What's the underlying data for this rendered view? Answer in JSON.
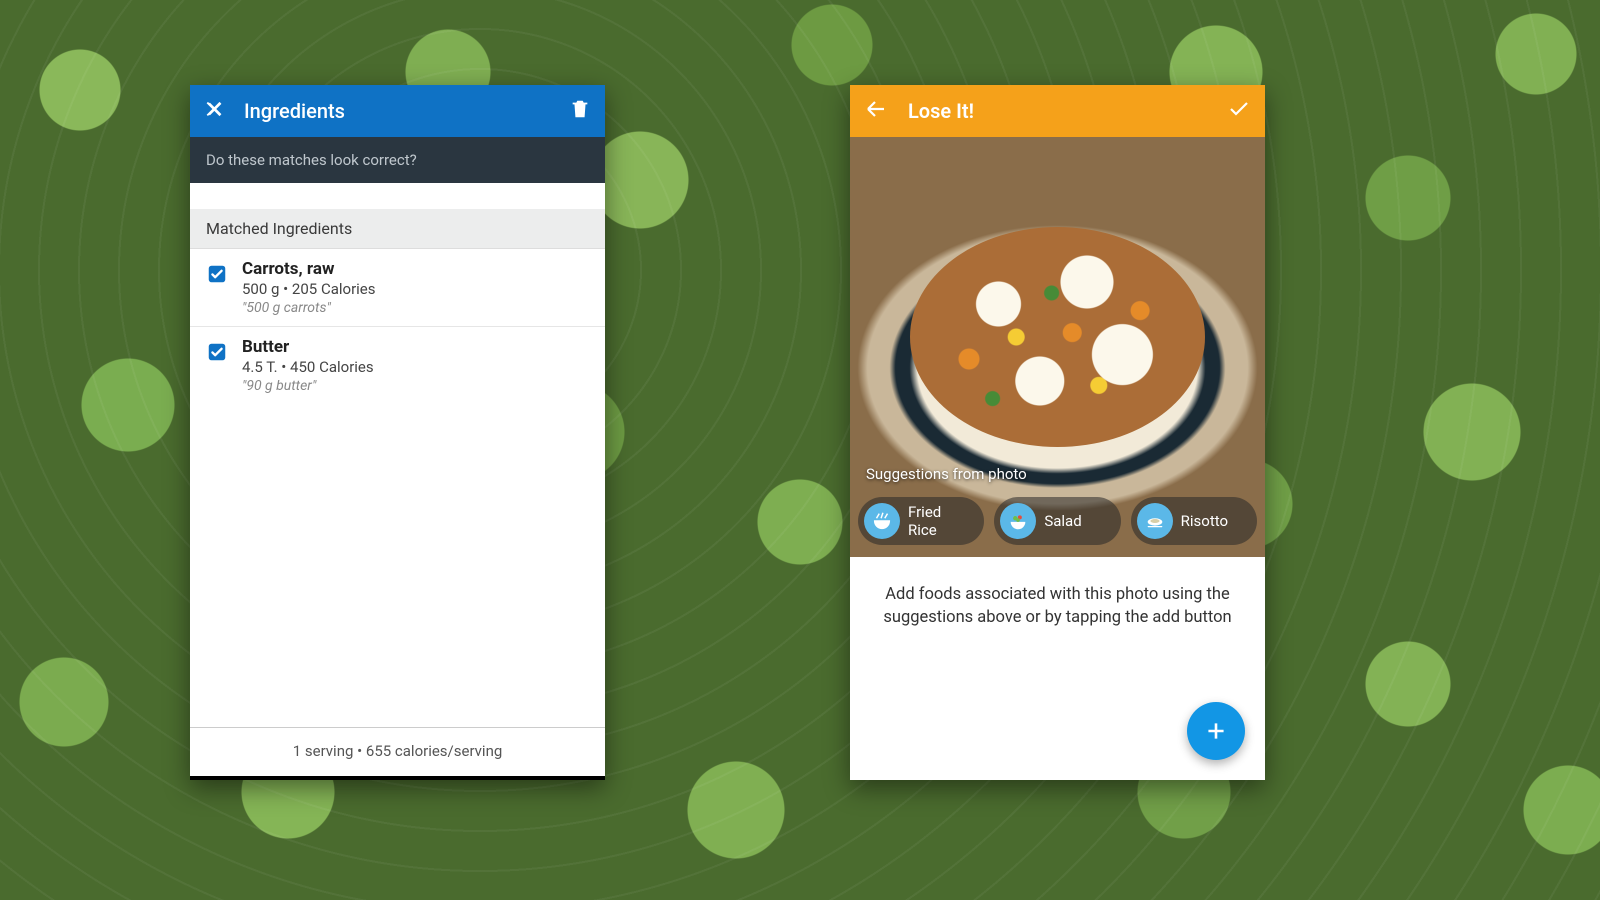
{
  "left": {
    "toolbar_title": "Ingredients",
    "subheader": "Do these matches look correct?",
    "section_label": "Matched Ingredients",
    "items": [
      {
        "name": "Carrots, raw",
        "meta": "500 g • 205 Calories",
        "orig": "\"500 g carrots\""
      },
      {
        "name": "Butter",
        "meta": "4.5 T. • 450 Calories",
        "orig": "\"90 g butter\""
      }
    ],
    "footer": "1 serving • 655 calories/serving"
  },
  "right": {
    "toolbar_title": "Lose It!",
    "suggestions_label": "Suggestions from photo",
    "chips": [
      "Fried Rice",
      "Salad",
      "Risotto"
    ],
    "body_text": "Add foods associated with this photo using the suggestions above or by tapping the add button"
  }
}
